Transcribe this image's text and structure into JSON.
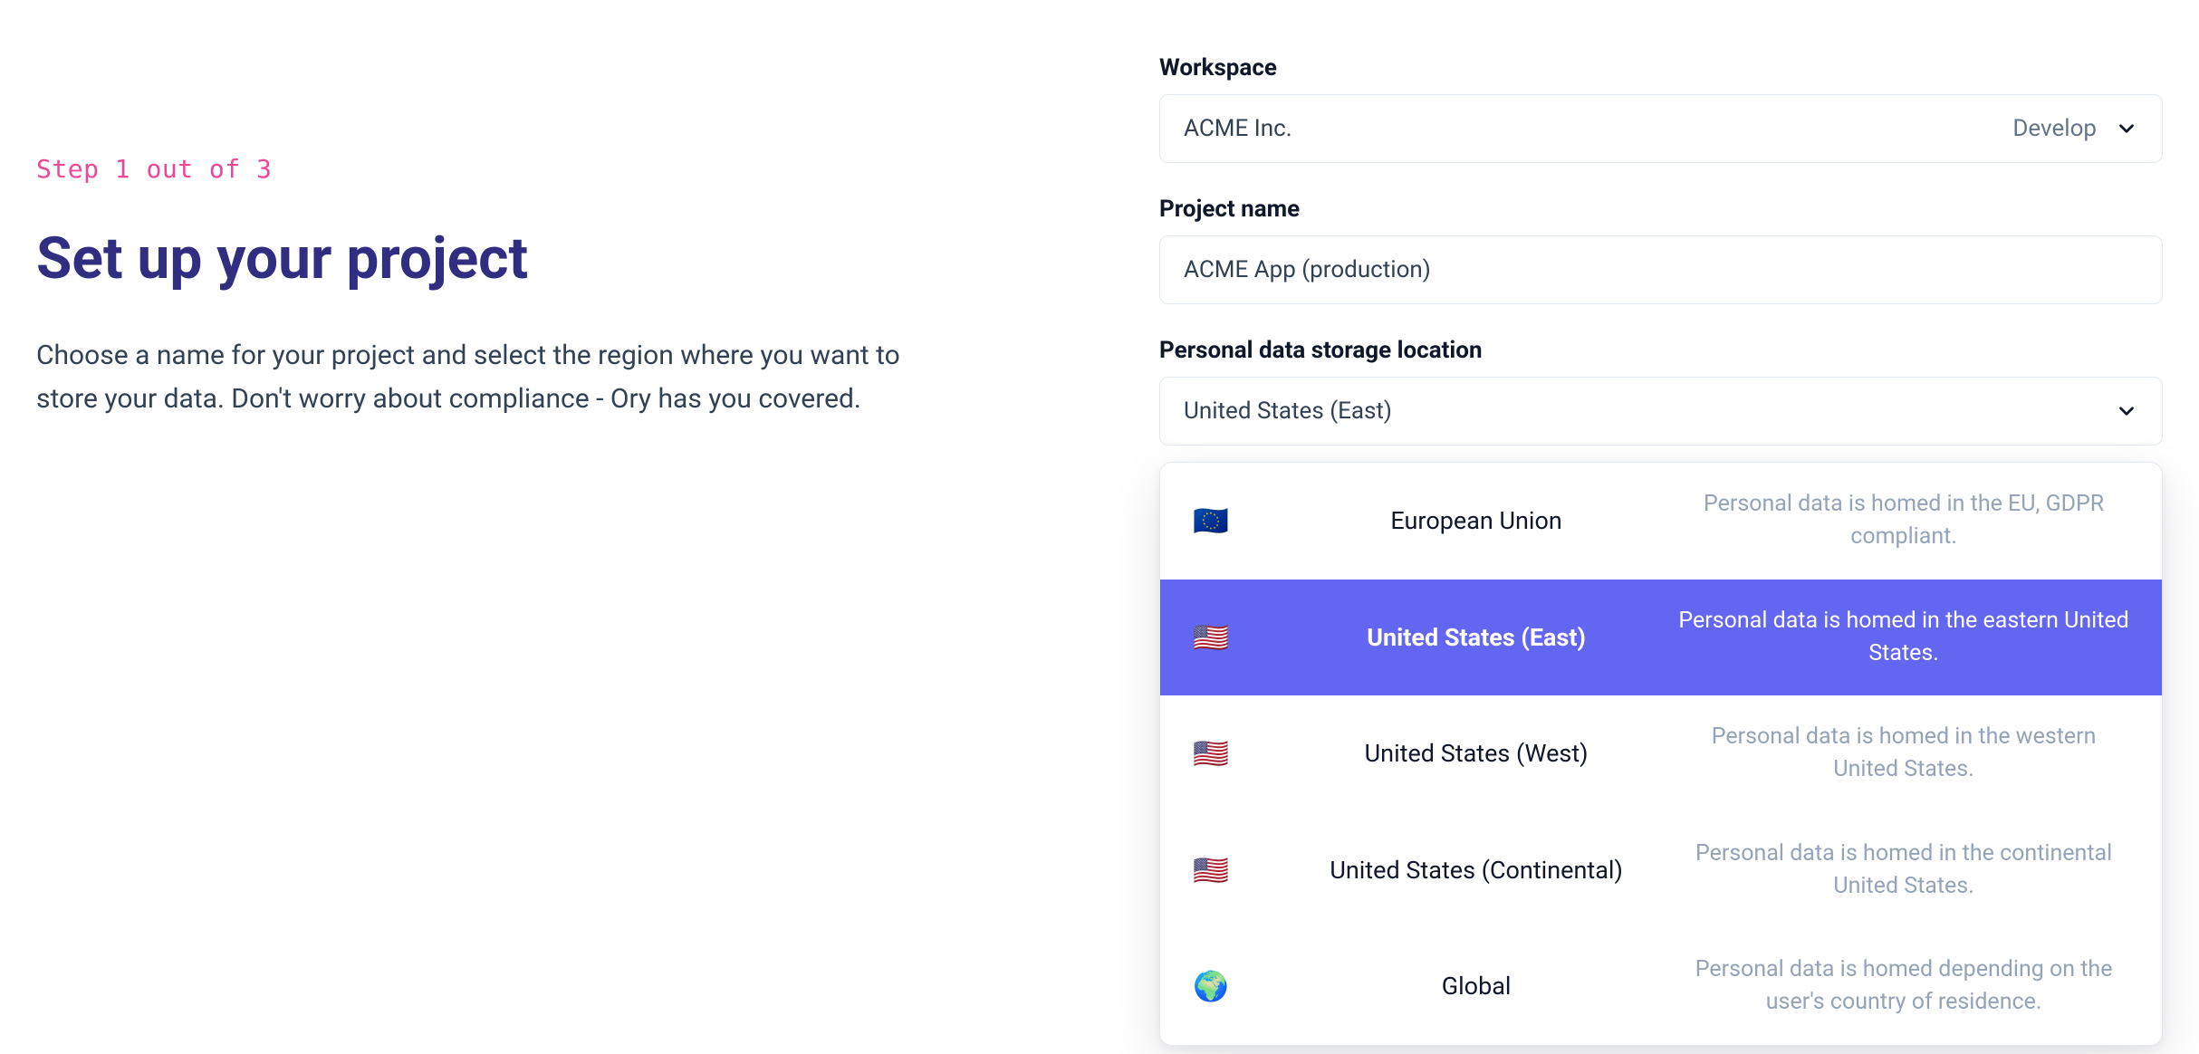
{
  "left": {
    "step_label": "Step 1 out of 3",
    "title": "Set up your project",
    "description": "Choose a name for your project and select the region where you want to store your data. Don't worry about compliance - Ory has you covered."
  },
  "workspace": {
    "label": "Workspace",
    "value": "ACME Inc.",
    "tag": "Develop"
  },
  "project_name": {
    "label": "Project name",
    "value": "ACME App (production)"
  },
  "storage": {
    "label": "Personal data storage location",
    "value": "United States (East)",
    "options": [
      {
        "flag": "🇪🇺",
        "name": "European Union",
        "desc": "Personal data is homed in the EU, GDPR compliant.",
        "selected": false
      },
      {
        "flag": "🇺🇸",
        "name": "United States (East)",
        "desc": "Personal data is homed in the eastern United States.",
        "selected": true
      },
      {
        "flag": "🇺🇸",
        "name": "United States (West)",
        "desc": "Personal data is homed in the western United States.",
        "selected": false
      },
      {
        "flag": "🇺🇸",
        "name": "United States (Continental)",
        "desc": "Personal data is homed in the continental United States.",
        "selected": false
      },
      {
        "flag": "🌍",
        "name": "Global",
        "desc": "Personal data is homed depending on the user's country of residence.",
        "selected": false
      }
    ]
  }
}
